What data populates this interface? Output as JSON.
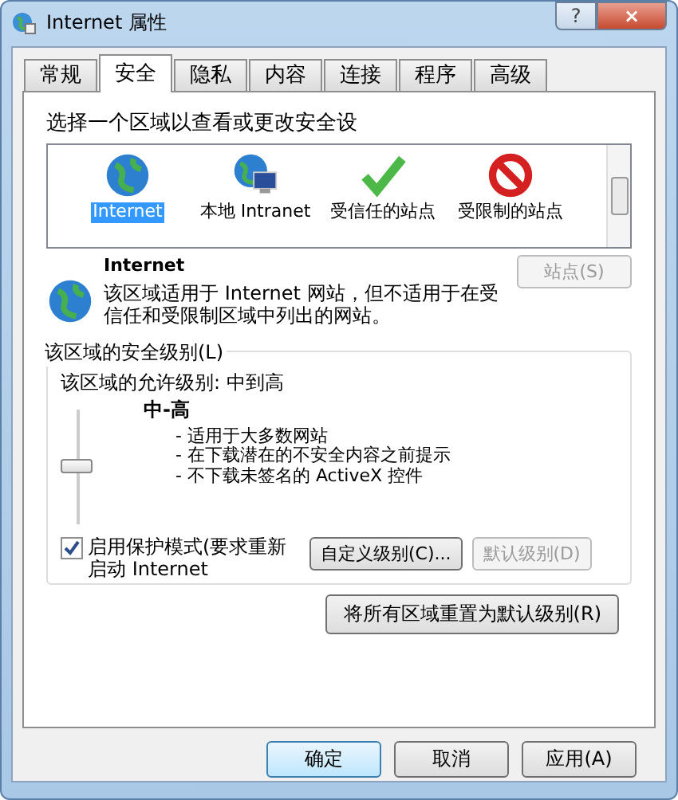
{
  "window": {
    "title": "Internet 属性",
    "help": "?",
    "close": "×"
  },
  "tabs": [
    {
      "label": "常规",
      "selected": false
    },
    {
      "label": "安全",
      "selected": true
    },
    {
      "label": "隐私",
      "selected": false
    },
    {
      "label": "内容",
      "selected": false
    },
    {
      "label": "连接",
      "selected": false
    },
    {
      "label": "程序",
      "selected": false
    },
    {
      "label": "高级",
      "selected": false
    }
  ],
  "zone_prompt": "选择一个区域以查看或更改安全设",
  "zones": [
    {
      "kind": "globe",
      "label": "Internet",
      "selected": true
    },
    {
      "kind": "intranet",
      "label": "本地 Intranet",
      "selected": false
    },
    {
      "kind": "trusted",
      "label": "受信任的站点",
      "selected": false
    },
    {
      "kind": "restricted",
      "label": "受限制的站点",
      "selected": false
    }
  ],
  "zone_info": {
    "title": "Internet",
    "description": "该区域适用于 Internet 网站，但不适用于在受信任和受限制区域中列出的网站。",
    "sites_button": {
      "label": "站点(S)",
      "disabled": true
    }
  },
  "security_level": {
    "group_title": "该区域的安全级别(L)",
    "allowed": "该区域的允许级别: 中到高",
    "level_name": "中-高",
    "level": 0.5,
    "bullets": [
      "- 适用于大多数网站",
      "- 在下载潜在的不安全内容之前提示",
      "- 不下载未签名的 ActiveX 控件"
    ],
    "protected_mode": {
      "label": "启用保护模式(要求重新启动 Internet",
      "checked": true
    },
    "buttons": [
      {
        "label": "自定义级别(C)...",
        "disabled": false
      },
      {
        "label": "默认级别(D)",
        "disabled": true
      }
    ]
  },
  "reset_button": "将所有区域重置为默认级别(R)",
  "footer_buttons": [
    {
      "label": "确定",
      "kind": "default"
    },
    {
      "label": "取消",
      "kind": "normal"
    },
    {
      "label": "应用(A)",
      "kind": "normal"
    }
  ]
}
